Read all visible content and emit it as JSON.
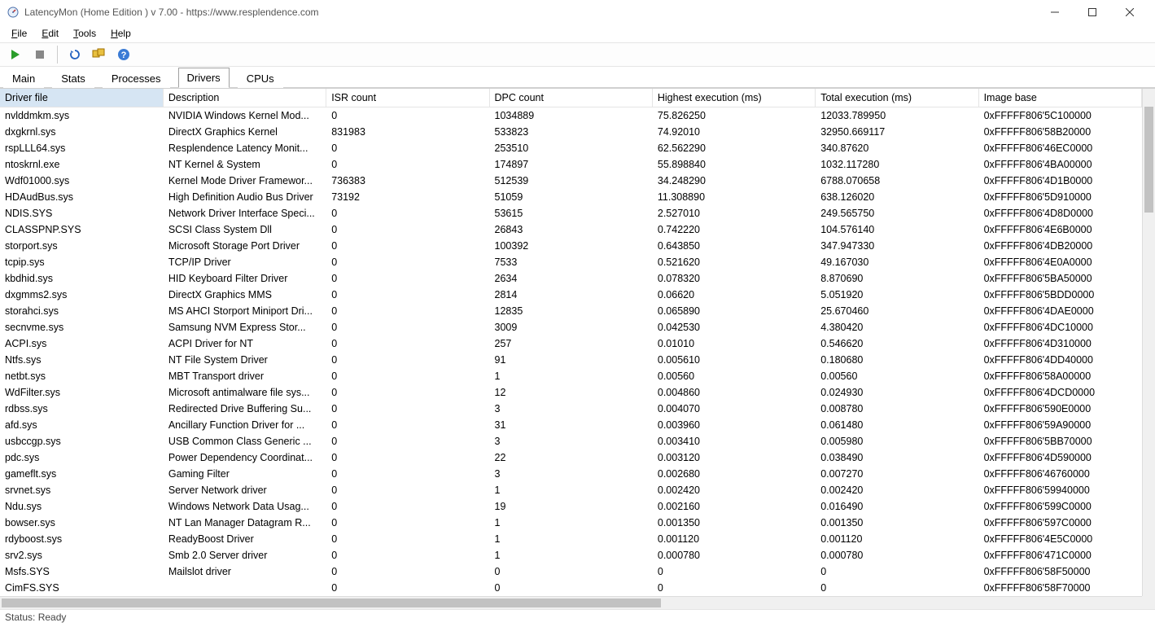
{
  "window": {
    "title": "LatencyMon  (Home Edition )  v 7.00 - https://www.resplendence.com"
  },
  "menubar": {
    "items": [
      "File",
      "Edit",
      "Tools",
      "Help"
    ]
  },
  "toolbar": {
    "buttons": [
      "play",
      "stop",
      "refresh",
      "select-all",
      "help"
    ]
  },
  "tabs": {
    "items": [
      "Main",
      "Stats",
      "Processes",
      "Drivers",
      "CPUs"
    ],
    "active_index": 3
  },
  "table": {
    "columns": [
      "Driver file",
      "Description",
      "ISR count",
      "DPC count",
      "Highest execution (ms)",
      "Total execution (ms)",
      "Image base"
    ],
    "sorted_col": 0,
    "rows": [
      [
        "nvlddmkm.sys",
        "NVIDIA Windows Kernel Mod...",
        "0",
        "1034889",
        "75.826250",
        "12033.789950",
        "0xFFFFF806'5C100000"
      ],
      [
        "dxgkrnl.sys",
        "DirectX Graphics Kernel",
        "831983",
        "533823",
        "74.92010",
        "32950.669117",
        "0xFFFFF806'58B20000"
      ],
      [
        "rspLLL64.sys",
        "Resplendence Latency Monit...",
        "0",
        "253510",
        "62.562290",
        "340.87620",
        "0xFFFFF806'46EC0000"
      ],
      [
        "ntoskrnl.exe",
        "NT Kernel & System",
        "0",
        "174897",
        "55.898840",
        "1032.117280",
        "0xFFFFF806'4BA00000"
      ],
      [
        "Wdf01000.sys",
        "Kernel Mode Driver Framewor...",
        "736383",
        "512539",
        "34.248290",
        "6788.070658",
        "0xFFFFF806'4D1B0000"
      ],
      [
        "HDAudBus.sys",
        "High Definition Audio Bus Driver",
        "73192",
        "51059",
        "11.308890",
        "638.126020",
        "0xFFFFF806'5D910000"
      ],
      [
        "NDIS.SYS",
        "Network Driver Interface Speci...",
        "0",
        "53615",
        "2.527010",
        "249.565750",
        "0xFFFFF806'4D8D0000"
      ],
      [
        "CLASSPNP.SYS",
        "SCSI Class System Dll",
        "0",
        "26843",
        "0.742220",
        "104.576140",
        "0xFFFFF806'4E6B0000"
      ],
      [
        "storport.sys",
        "Microsoft Storage Port Driver",
        "0",
        "100392",
        "0.643850",
        "347.947330",
        "0xFFFFF806'4DB20000"
      ],
      [
        "tcpip.sys",
        "TCP/IP Driver",
        "0",
        "7533",
        "0.521620",
        "49.167030",
        "0xFFFFF806'4E0A0000"
      ],
      [
        "kbdhid.sys",
        "HID Keyboard Filter Driver",
        "0",
        "2634",
        "0.078320",
        "8.870690",
        "0xFFFFF806'5BA50000"
      ],
      [
        "dxgmms2.sys",
        "DirectX Graphics MMS",
        "0",
        "2814",
        "0.06620",
        "5.051920",
        "0xFFFFF806'5BDD0000"
      ],
      [
        "storahci.sys",
        "MS AHCI Storport Miniport Dri...",
        "0",
        "12835",
        "0.065890",
        "25.670460",
        "0xFFFFF806'4DAE0000"
      ],
      [
        "secnvme.sys",
        "Samsung NVM Express Stor...",
        "0",
        "3009",
        "0.042530",
        "4.380420",
        "0xFFFFF806'4DC10000"
      ],
      [
        "ACPI.sys",
        "ACPI Driver for NT",
        "0",
        "257",
        "0.01010",
        "0.546620",
        "0xFFFFF806'4D310000"
      ],
      [
        "Ntfs.sys",
        "NT File System Driver",
        "0",
        "91",
        "0.005610",
        "0.180680",
        "0xFFFFF806'4DD40000"
      ],
      [
        "netbt.sys",
        "MBT Transport driver",
        "0",
        "1",
        "0.00560",
        "0.00560",
        "0xFFFFF806'58A00000"
      ],
      [
        "WdFilter.sys",
        "Microsoft antimalware file sys...",
        "0",
        "12",
        "0.004860",
        "0.024930",
        "0xFFFFF806'4DCD0000"
      ],
      [
        "rdbss.sys",
        "Redirected Drive Buffering Su...",
        "0",
        "3",
        "0.004070",
        "0.008780",
        "0xFFFFF806'590E0000"
      ],
      [
        "afd.sys",
        "Ancillary Function Driver for ...",
        "0",
        "31",
        "0.003960",
        "0.061480",
        "0xFFFFF806'59A90000"
      ],
      [
        "usbccgp.sys",
        "USB Common Class Generic ...",
        "0",
        "3",
        "0.003410",
        "0.005980",
        "0xFFFFF806'5BB70000"
      ],
      [
        "pdc.sys",
        "Power Dependency Coordinat...",
        "0",
        "22",
        "0.003120",
        "0.038490",
        "0xFFFFF806'4D590000"
      ],
      [
        "gameflt.sys",
        "Gaming Filter",
        "0",
        "3",
        "0.002680",
        "0.007270",
        "0xFFFFF806'46760000"
      ],
      [
        "srvnet.sys",
        "Server Network driver",
        "0",
        "1",
        "0.002420",
        "0.002420",
        "0xFFFFF806'59940000"
      ],
      [
        "Ndu.sys",
        "Windows Network Data Usag...",
        "0",
        "19",
        "0.002160",
        "0.016490",
        "0xFFFFF806'599C0000"
      ],
      [
        "bowser.sys",
        "NT Lan Manager Datagram R...",
        "0",
        "1",
        "0.001350",
        "0.001350",
        "0xFFFFF806'597C0000"
      ],
      [
        "rdyboost.sys",
        "ReadyBoost Driver",
        "0",
        "1",
        "0.001120",
        "0.001120",
        "0xFFFFF806'4E5C0000"
      ],
      [
        "srv2.sys",
        "Smb 2.0 Server driver",
        "0",
        "1",
        "0.000780",
        "0.000780",
        "0xFFFFF806'471C0000"
      ],
      [
        "Msfs.SYS",
        "Mailslot driver",
        "0",
        "0",
        "0",
        "0",
        "0xFFFFF806'58F50000"
      ],
      [
        "CimFS.SYS",
        "",
        "0",
        "0",
        "0",
        "0",
        "0xFFFFF806'58F70000"
      ]
    ]
  },
  "status": {
    "text": "Status: Ready"
  }
}
